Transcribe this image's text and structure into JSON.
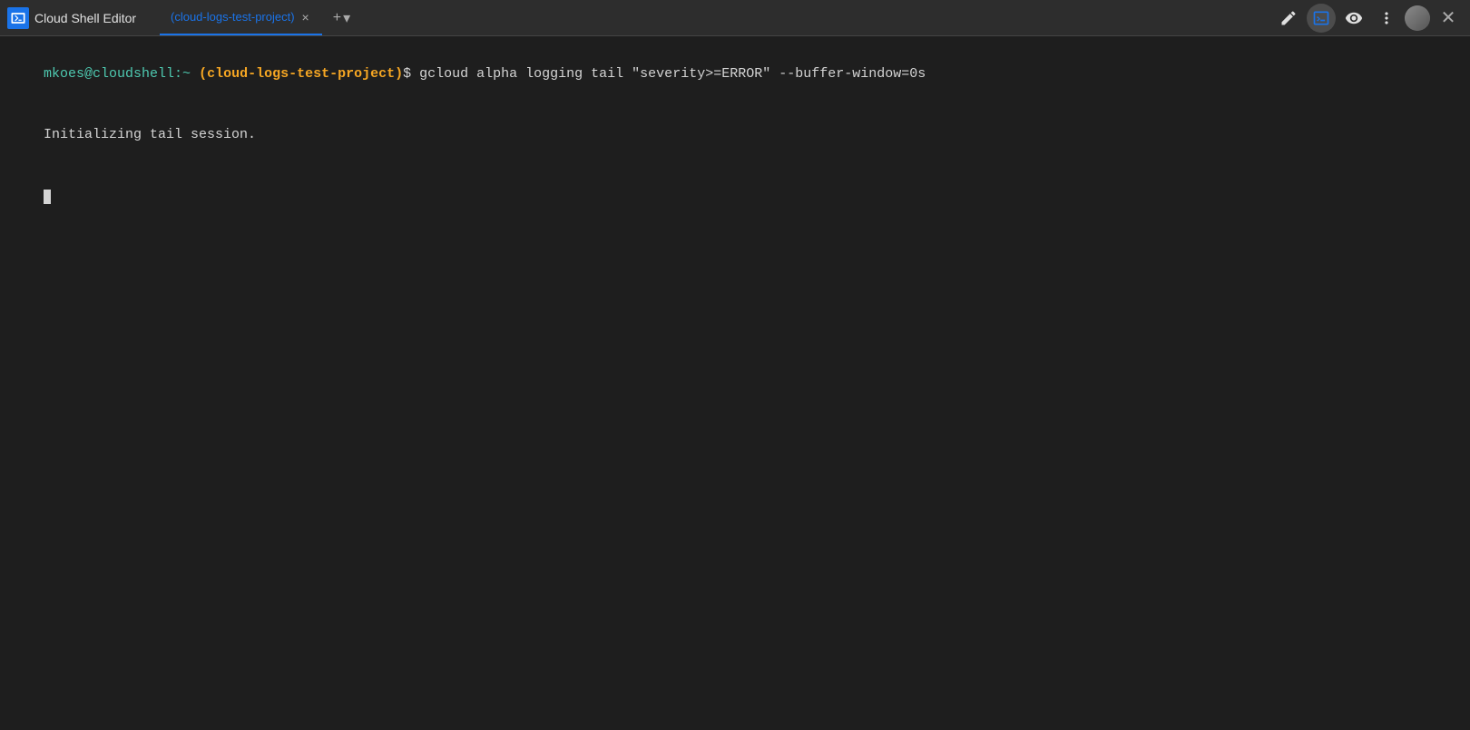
{
  "header": {
    "logo_text": ">_",
    "app_title": "Cloud Shell Editor",
    "tab_label": "(cloud-logs-test-project)",
    "tab_close_symbol": "×",
    "tab_add_symbol": "+",
    "tab_add_dropdown": "▾"
  },
  "toolbar": {
    "edit_icon": "✏",
    "terminal_icon": "⬛",
    "preview_icon": "⬜",
    "menu_icon": "⋮",
    "close_icon": "✕"
  },
  "terminal": {
    "prompt_user": "mkoes@cloudshell:",
    "prompt_tilde": "~",
    "prompt_project": "(cloud-logs-test-project)",
    "prompt_dollar": "$",
    "command": " gcloud alpha logging tail \"severity>=ERROR\" --buffer-window=0s",
    "output_line1": "Initializing tail session."
  }
}
